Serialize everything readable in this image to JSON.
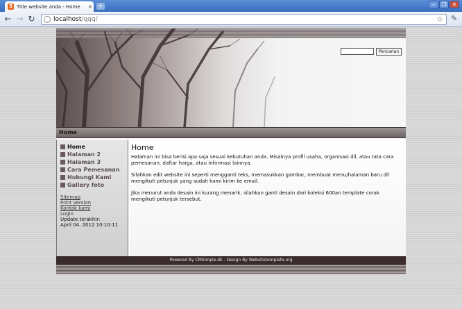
{
  "browser": {
    "tab_title": "Title website anda - Home",
    "tab_favicon": "html-icon",
    "new_tab_label": "+",
    "url_host": "localhost",
    "url_path": "/qqq/",
    "back": "←",
    "forward": "→",
    "reload": "↻",
    "star": "☆",
    "wrench": "🔧",
    "min": "–",
    "max": "❐",
    "close": "✕"
  },
  "site": {
    "search_button": "Pencarian",
    "search_value": "",
    "breadcrumb": "Home",
    "menu": [
      {
        "label": "Home",
        "active": true
      },
      {
        "label": "Halaman 2"
      },
      {
        "label": "Halaman 3"
      },
      {
        "label": "Cara Pemesanan"
      },
      {
        "label": "Hubungi Kami"
      },
      {
        "label": "Gallery foto"
      }
    ],
    "links": [
      "Sitemap",
      "Print Version",
      "Kontak kami",
      "Login"
    ],
    "update_label": "Update terakhir:",
    "update_date": "April 04. 2012 10:10:11",
    "content": {
      "title": "Home",
      "p1": "Halaman ini bisa berisi apa saja sesuai kebutuhan anda. Misalnya profil usaha, organisasi dll, atau tata cara pemesanan, daftar harga, atau informasi lainnya.",
      "p2": "Silahkan edit website ini seperti mengganti teks, memasukkan gambar, membuat menu/halaman baru dll mengikuti petunjuk yang sudah kami kirim ke email.",
      "p3": "Jika menurut anda desain ini kurang menarik, silahkan ganti desain dari koleksi 600an template corak mengikuti petunjuk tersebut."
    },
    "footer": "Powered By CMSImple.dk - Design By Websitetemplate.org"
  },
  "colors": {
    "header_dark": "#5b4e4e",
    "footer": "#3b2c2c",
    "bullet": "#6b5a5a"
  }
}
